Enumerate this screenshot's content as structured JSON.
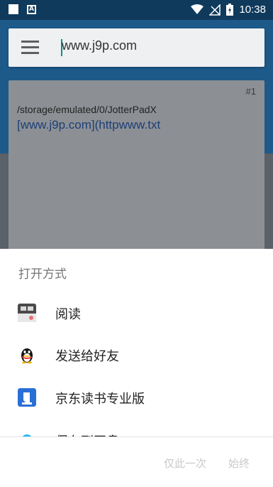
{
  "status_bar": {
    "time": "10:38"
  },
  "search": {
    "url": "www.j9p.com"
  },
  "card": {
    "number": "#1",
    "path": "/storage/emulated/0/JotterPadX",
    "link": "[www.j9p.com](httpwww.txt"
  },
  "sheet": {
    "title": "打开方式",
    "items": [
      {
        "label": "阅读",
        "icon": "reader-app-icon"
      },
      {
        "label": "发送给好友",
        "icon": "qq-penguin-icon"
      },
      {
        "label": "京东读书专业版",
        "icon": "jd-reader-icon"
      },
      {
        "label": "保存到网盘",
        "icon": "cloud-drive-icon"
      }
    ],
    "just_once": "仅此一次",
    "always": "始终"
  },
  "colors": {
    "status_bar": "#0f3a5c",
    "app_bar": "#1d5a8a",
    "dim_overlay": "#5a6168",
    "jd_blue": "#2a6fd6"
  }
}
